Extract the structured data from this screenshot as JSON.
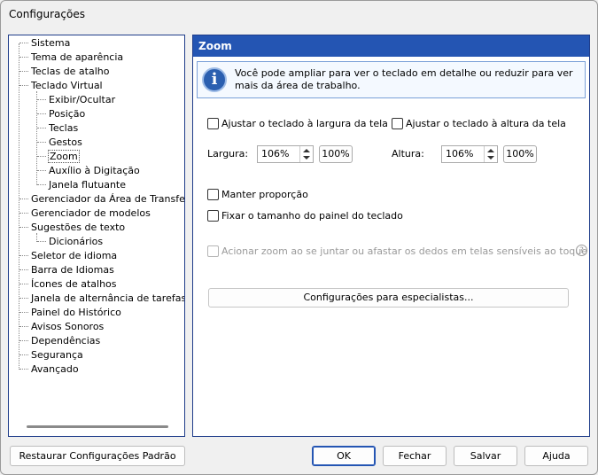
{
  "window": {
    "title": "Configurações"
  },
  "tree": {
    "items": [
      {
        "label": "Sistema",
        "level": 0
      },
      {
        "label": "Tema de aparência",
        "level": 0
      },
      {
        "label": "Teclas de atalho",
        "level": 0
      },
      {
        "label": "Teclado Virtual",
        "level": 0
      },
      {
        "label": "Exibir/Ocultar",
        "level": 1
      },
      {
        "label": "Posição",
        "level": 1
      },
      {
        "label": "Teclas",
        "level": 1
      },
      {
        "label": "Gestos",
        "level": 1
      },
      {
        "label": "Zoom",
        "level": 1,
        "selected": true
      },
      {
        "label": "Auxílio à Digitação",
        "level": 1
      },
      {
        "label": "Janela flutuante",
        "level": 1
      },
      {
        "label": "Gerenciador da Área de Transferência",
        "level": 0
      },
      {
        "label": "Gerenciador de modelos",
        "level": 0
      },
      {
        "label": "Sugestões de texto",
        "level": 0
      },
      {
        "label": "Dicionários",
        "level": 1
      },
      {
        "label": "Seletor de idioma",
        "level": 0
      },
      {
        "label": "Barra de Idiomas",
        "level": 0
      },
      {
        "label": "Ícones de atalhos",
        "level": 0
      },
      {
        "label": "Janela de alternância de tarefas",
        "level": 0
      },
      {
        "label": "Painel do Histórico",
        "level": 0
      },
      {
        "label": "Avisos Sonoros",
        "level": 0
      },
      {
        "label": "Dependências",
        "level": 0
      },
      {
        "label": "Segurança",
        "level": 0
      },
      {
        "label": "Avançado",
        "level": 0
      }
    ]
  },
  "panel": {
    "header": "Zoom",
    "info_text": "Você pode ampliar para ver o teclado em detalhe ou reduzir para ver mais da área de trabalho.",
    "fit_width_label": "Ajustar o teclado à largura da tela",
    "fit_height_label": "Ajustar o teclado à altura da tela",
    "width_label": "Largura:",
    "width_value": "106%",
    "width_reset": "100%",
    "height_label": "Altura:",
    "height_value": "106%",
    "height_reset": "100%",
    "keep_ratio_label": "Manter proporção",
    "fix_size_label": "Fixar o tamanho do painel do teclado",
    "pinch_zoom_label": "Acionar zoom ao se juntar ou afastar os dedos em telas sensíveis ao toque (touchscre",
    "expert_button": "Configurações para especialistas..."
  },
  "footer": {
    "restore_label": "Restaurar Configurações Padrão",
    "ok_label": "OK",
    "close_label": "Fechar",
    "save_label": "Salvar",
    "help_label": "Ajuda"
  }
}
